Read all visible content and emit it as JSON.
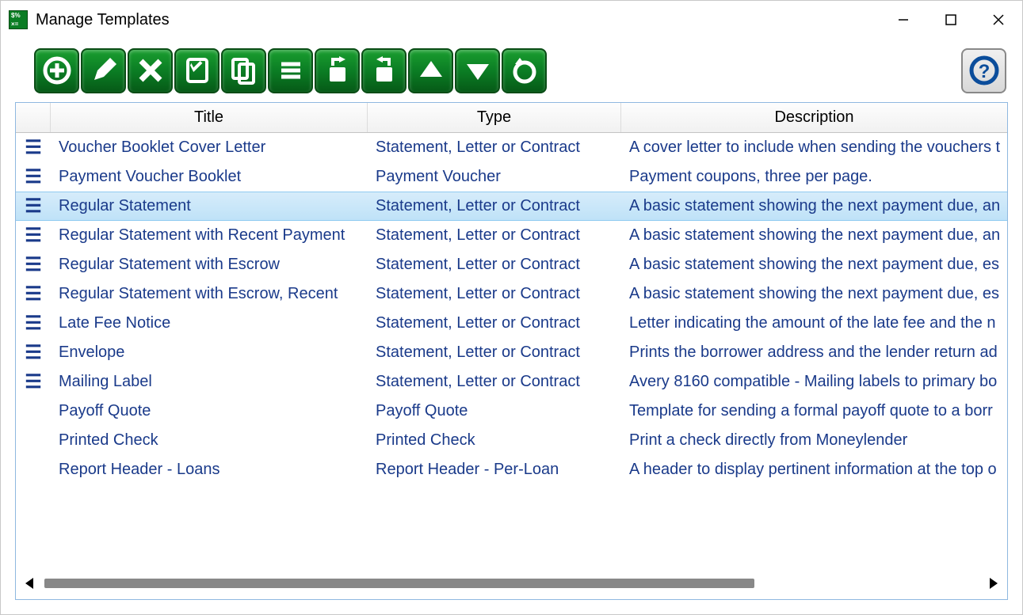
{
  "window": {
    "title": "Manage Templates"
  },
  "toolbar": {
    "buttons": [
      "add",
      "edit",
      "delete",
      "duplicate",
      "copy",
      "list",
      "import",
      "export",
      "move-up",
      "move-down",
      "reset"
    ]
  },
  "grid": {
    "headers": {
      "title": "Title",
      "type": "Type",
      "description": "Description"
    },
    "selected_index": 2,
    "rows": [
      {
        "handle": true,
        "title": "Voucher Booklet Cover Letter",
        "type": "Statement, Letter or Contract",
        "description": "A cover letter to include when sending the vouchers t"
      },
      {
        "handle": true,
        "title": "Payment Voucher Booklet",
        "type": "Payment Voucher",
        "description": "Payment coupons, three per page."
      },
      {
        "handle": true,
        "title": "Regular Statement",
        "type": "Statement, Letter or Contract",
        "description": "A basic statement showing the next payment due, an"
      },
      {
        "handle": true,
        "title": "Regular Statement with Recent Payment",
        "type": "Statement, Letter or Contract",
        "description": "A basic statement showing the next payment due, an"
      },
      {
        "handle": true,
        "title": "Regular Statement with Escrow",
        "type": "Statement, Letter or Contract",
        "description": "A basic statement showing the next payment due, es"
      },
      {
        "handle": true,
        "title": "Regular Statement with Escrow, Recent",
        "type": "Statement, Letter or Contract",
        "description": "A basic statement showing the next payment due, es"
      },
      {
        "handle": true,
        "title": "Late Fee Notice",
        "type": "Statement, Letter or Contract",
        "description": "Letter indicating the amount of the late fee and the n"
      },
      {
        "handle": true,
        "title": "Envelope",
        "type": "Statement, Letter or Contract",
        "description": "Prints the borrower address and the lender return ad"
      },
      {
        "handle": true,
        "title": "Mailing Label",
        "type": "Statement, Letter or Contract",
        "description": "Avery 8160 compatible - Mailing labels to primary bo"
      },
      {
        "handle": false,
        "title": "Payoff Quote",
        "type": "Payoff Quote",
        "description": "Template for sending a formal payoff quote to a borr"
      },
      {
        "handle": false,
        "title": "Printed Check",
        "type": "Printed Check",
        "description": "Print a check directly from Moneylender"
      },
      {
        "handle": false,
        "title": "Report Header - Loans",
        "type": "Report Header - Per-Loan",
        "description": "A header to display pertinent information at the top o"
      }
    ]
  }
}
